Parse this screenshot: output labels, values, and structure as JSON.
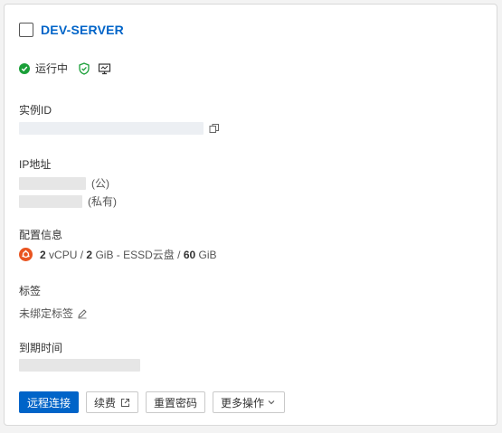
{
  "instance": {
    "name": "DEV-SERVER",
    "status": "运行中"
  },
  "fields": {
    "instance_id_label": "实例ID",
    "ip_label": "IP地址",
    "ip_public_suffix": "(公)",
    "ip_private_suffix": "(私有)",
    "config_label": "配置信息",
    "config": {
      "cpu_num": "2",
      "cpu_unit": "vCPU",
      "sep1": "/",
      "mem_num": "2",
      "mem_unit": "GiB",
      "disk_type": "- ESSD云盘",
      "sep2": "/",
      "disk_num": "60",
      "disk_unit": "GiB"
    },
    "tags_label": "标签",
    "tags_value": "未绑定标签",
    "expire_label": "到期时间"
  },
  "icons": {
    "status": "check-circle-icon",
    "security": "shield-check-icon",
    "monitor": "monitor-icon",
    "copy": "copy-icon",
    "os": "ubuntu-icon",
    "edit": "pencil-icon",
    "external": "external-link-icon",
    "dropdown": "chevron-down-icon"
  },
  "actions": {
    "remote_connect": "远程连接",
    "renew": "续费",
    "reset_password": "重置密码",
    "more": "更多操作"
  },
  "colors": {
    "primary": "#0064c8",
    "status_green": "#1a9f38",
    "ubuntu_orange": "#e95420"
  }
}
